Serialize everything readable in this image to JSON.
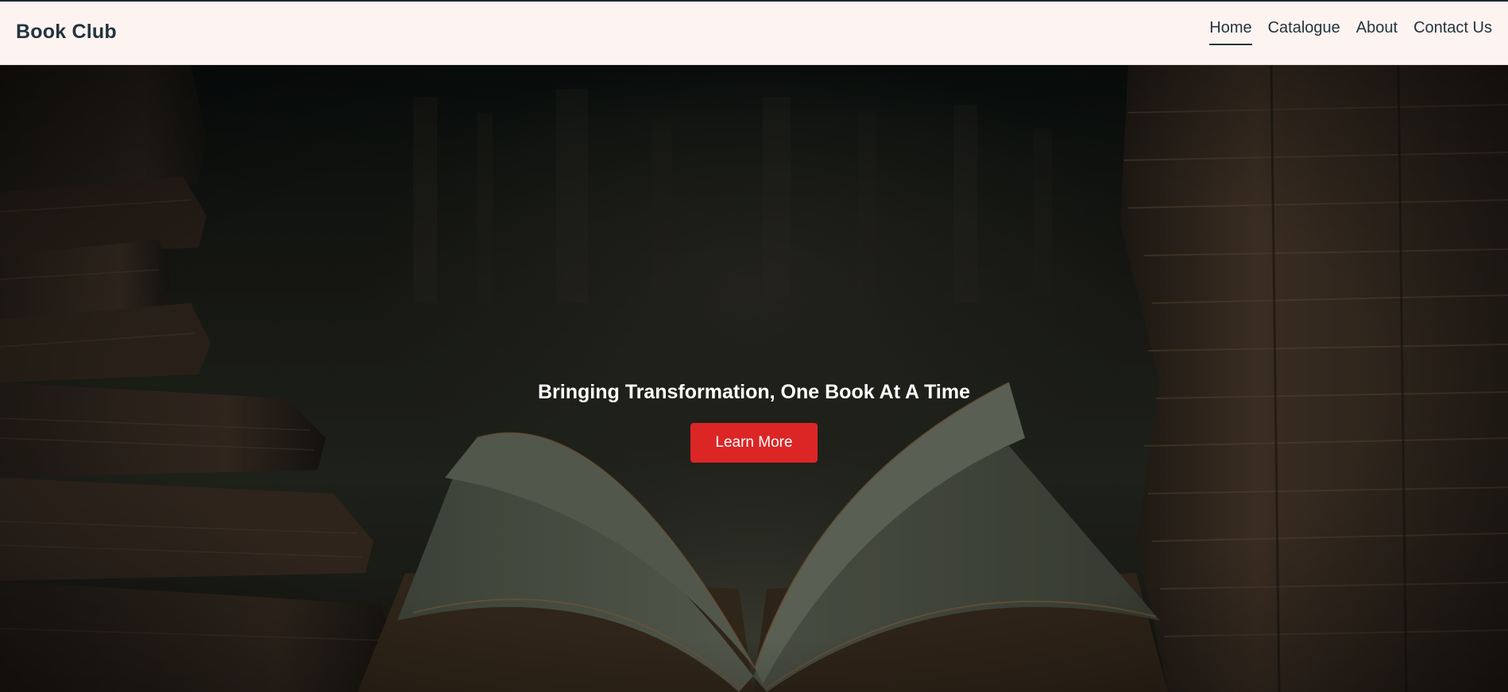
{
  "brand": "Book Club",
  "nav": {
    "items": [
      {
        "label": "Home",
        "active": true
      },
      {
        "label": "Catalogue",
        "active": false
      },
      {
        "label": "About",
        "active": false
      },
      {
        "label": "Contact Us",
        "active": false
      }
    ]
  },
  "hero": {
    "title": "Bringing Transformation, One Book At A Time",
    "button_label": "Learn More"
  },
  "colors": {
    "navbar_background": "#fdf3f1",
    "brand_text": "#22343d",
    "accent_button": "#dc2626",
    "hero_text": "#ffffff"
  }
}
